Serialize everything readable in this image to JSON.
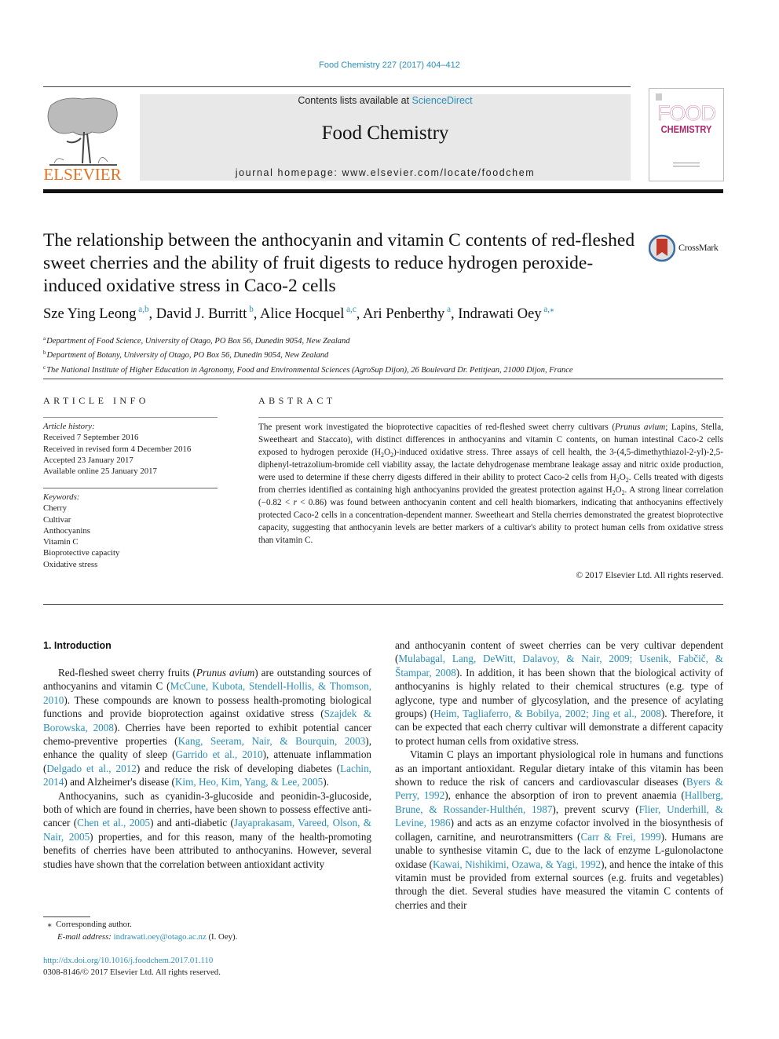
{
  "header": {
    "citation": "Food Chemistry 227 (2017) 404–412",
    "contents_prefix": "Contents lists available at ",
    "contents_link": "ScienceDirect",
    "journal_title": "Food Chemistry",
    "homepage": "journal homepage: www.elsevier.com/locate/foodchem",
    "publisher_logo": "ELSEVIER",
    "cover_line1": "FOOD",
    "cover_line2": "CHEMISTRY",
    "crossmark": "CrossMark"
  },
  "article": {
    "title": "The relationship between the anthocyanin and vitamin C contents of red-fleshed sweet cherries and the ability of fruit digests to reduce hydrogen peroxide-induced oxidative stress in Caco-2 cells",
    "authors": [
      {
        "name": "Sze Ying Leong",
        "sup": "a,b",
        "sep": ", "
      },
      {
        "name": "David J. Burritt",
        "sup": "b",
        "sep": ", "
      },
      {
        "name": "Alice Hocquel",
        "sup": "a,c",
        "sep": ", "
      },
      {
        "name": "Ari Penberthy",
        "sup": "a",
        "sep": ", "
      },
      {
        "name": "Indrawati Oey",
        "sup": "a,⁎",
        "sep": ""
      }
    ],
    "affiliations": [
      {
        "mark": "a",
        "text": "Department of Food Science, University of Otago, PO Box 56, Dunedin 9054, New Zealand"
      },
      {
        "mark": "b",
        "text": "Department of Botany, University of Otago, PO Box 56, Dunedin 9054, New Zealand"
      },
      {
        "mark": "c",
        "text": "The National Institute of Higher Education in Agronomy, Food and Environmental Sciences (AgroSup Dijon), 26 Boulevard Dr. Petitjean, 21000 Dijon, France"
      }
    ]
  },
  "article_info": {
    "heading": "ARTICLE INFO",
    "history_label": "Article history:",
    "history": [
      "Received 7 September 2016",
      "Received in revised form 4 December 2016",
      "Accepted 23 January 2017",
      "Available online 25 January 2017"
    ],
    "keywords_label": "Keywords:",
    "keywords": [
      "Cherry",
      "Cultivar",
      "Anthocyanins",
      "Vitamin C",
      "Bioprotective capacity",
      "Oxidative stress"
    ]
  },
  "abstract": {
    "heading": "ABSTRACT",
    "segments": [
      {
        "t": "The present work investigated the bioprotective capacities of red-fleshed sweet cherry cultivars ("
      },
      {
        "t": "Prunus avium",
        "i": true
      },
      {
        "t": "; Lapins, Stella, Sweetheart and Staccato), with distinct differences in anthocyanins and vitamin C contents, on human intestinal Caco-2 cells exposed to hydrogen peroxide (H"
      },
      {
        "t": "2",
        "sub": true
      },
      {
        "t": "O"
      },
      {
        "t": "2",
        "sub": true
      },
      {
        "t": ")-induced oxidative stress. Three assays of cell health, the 3-(4,5-dimethythiazol-2-yl)-2,5-diphenyl-tetrazolium-bromide cell viability assay, the lactate dehydrogenase membrane leakage assay and nitric oxide production, were used to determine if these cherry digests differed in their ability to protect Caco-2 cells from H"
      },
      {
        "t": "2",
        "sub": true
      },
      {
        "t": "O"
      },
      {
        "t": "2",
        "sub": true
      },
      {
        "t": ". Cells treated with digests from cherries identified as containing high anthocyanins provided the greatest protection against H"
      },
      {
        "t": "2",
        "sub": true
      },
      {
        "t": "O"
      },
      {
        "t": "2",
        "sub": true
      },
      {
        "t": ". A strong linear correlation (−0.82 < "
      },
      {
        "t": "r",
        "i": true
      },
      {
        "t": " < 0.86) was found between anthocyanin content and cell health biomarkers, indicating that anthocyanins effectively protected Caco-2 cells in a concentration-dependent manner. Sweetheart and Stella cherries demonstrated the greatest bioprotective capacity, suggesting that anthocyanin levels are better markers of a cultivar's ability to protect human cells from oxidative stress than vitamin C."
      }
    ],
    "copyright": "© 2017 Elsevier Ltd. All rights reserved."
  },
  "body": {
    "section_heading": "1. Introduction",
    "left_paragraphs": [
      {
        "indent": true,
        "segments": [
          {
            "t": "Red-fleshed sweet cherry fruits ("
          },
          {
            "t": "Prunus avium",
            "i": true
          },
          {
            "t": ") are outstanding sources of anthocyanins and vitamin C ("
          },
          {
            "t": "McCune, Kubota, Stendell-Hollis, & Thomson, 2010",
            "link": true
          },
          {
            "t": "). These compounds are known to possess health-promoting biological functions and provide bioprotection against oxidative stress ("
          },
          {
            "t": "Szajdek & Borowska, 2008",
            "link": true
          },
          {
            "t": "). Cherries have been reported to exhibit potential cancer chemo-preventive properties ("
          },
          {
            "t": "Kang, Seeram, Nair, & Bourquin, 2003",
            "link": true
          },
          {
            "t": "), enhance the quality of sleep ("
          },
          {
            "t": "Garrido et al., 2010",
            "link": true
          },
          {
            "t": "), attenuate inflammation ("
          },
          {
            "t": "Delgado et al., 2012",
            "link": true
          },
          {
            "t": ") and reduce the risk of developing diabetes ("
          },
          {
            "t": "Lachin, 2014",
            "link": true
          },
          {
            "t": ") and Alzheimer's disease ("
          },
          {
            "t": "Kim, Heo, Kim, Yang, & Lee, 2005",
            "link": true
          },
          {
            "t": ")."
          }
        ]
      },
      {
        "indent": true,
        "segments": [
          {
            "t": "Anthocyanins, such as cyanidin-3-glucoside and peonidin-3-glucoside, both of which are found in cherries, have been shown to possess effective anti-cancer ("
          },
          {
            "t": "Chen et al., 2005",
            "link": true
          },
          {
            "t": ") and anti-diabetic ("
          },
          {
            "t": "Jayaprakasam, Vareed, Olson, & Nair, 2005",
            "link": true
          },
          {
            "t": ") properties, and for this reason, many of the health-promoting benefits of cherries have been attributed to anthocyanins. However, several studies have shown that the correlation between antioxidant activity"
          }
        ]
      }
    ],
    "right_paragraphs": [
      {
        "indent": false,
        "segments": [
          {
            "t": "and anthocyanin content of sweet cherries can be very cultivar dependent ("
          },
          {
            "t": "Mulabagal, Lang, DeWitt, Dalavoy, & Nair, 2009; Usenik, Fabčič, & Štampar, 2008",
            "link": true
          },
          {
            "t": "). In addition, it has been shown that the biological activity of anthocyanins is highly related to their chemical structures (e.g. type of aglycone, type and number of glycosylation, and the presence of acylating groups) ("
          },
          {
            "t": "Heim, Tagliaferro, & Bobilya, 2002; Jing et al., 2008",
            "link": true
          },
          {
            "t": "). Therefore, it can be expected that each cherry cultivar will demonstrate a different capacity to protect human cells from oxidative stress."
          }
        ]
      },
      {
        "indent": true,
        "segments": [
          {
            "t": "Vitamin C plays an important physiological role in humans and functions as an important antioxidant. Regular dietary intake of this vitamin has been shown to reduce the risk of cancers and cardiovascular diseases ("
          },
          {
            "t": "Byers & Perry, 1992",
            "link": true
          },
          {
            "t": "), enhance the absorption of iron to prevent anaemia ("
          },
          {
            "t": "Hallberg, Brune, & Rossander-Hulthén, 1987",
            "link": true
          },
          {
            "t": "), prevent scurvy ("
          },
          {
            "t": "Flier, Underhill, & Levine, 1986",
            "link": true
          },
          {
            "t": ") and acts as an enzyme cofactor involved in the biosynthesis of collagen, carnitine, and neurotransmitters ("
          },
          {
            "t": "Carr & Frei, 1999",
            "link": true
          },
          {
            "t": "). Humans are unable to synthesise vitamin C, due to the lack of enzyme L-gulonolactone oxidase ("
          },
          {
            "t": "Kawai, Nishikimi, Ozawa, & Yagi, 1992",
            "link": true
          },
          {
            "t": "), and hence the intake of this vitamin must be provided from external sources (e.g. fruits and vegetables) through the diet. Several studies have measured the vitamin C contents of cherries and their"
          }
        ]
      }
    ]
  },
  "footnotes": {
    "corresponding_mark": "⁎",
    "corresponding": "Corresponding author.",
    "email_label": "E-mail address:",
    "email": "indrawati.oey@otago.ac.nz",
    "email_suffix": " (I. Oey).",
    "doi": "http://dx.doi.org/10.1016/j.foodchem.2017.01.110",
    "issn": "0308-8146/© 2017 Elsevier Ltd. All rights reserved."
  },
  "colors": {
    "link": "#2a8fb8",
    "elsevier_orange": "#e9711c",
    "cover_magenta": "#b0256a",
    "banner_gray": "#e8e8e8"
  }
}
